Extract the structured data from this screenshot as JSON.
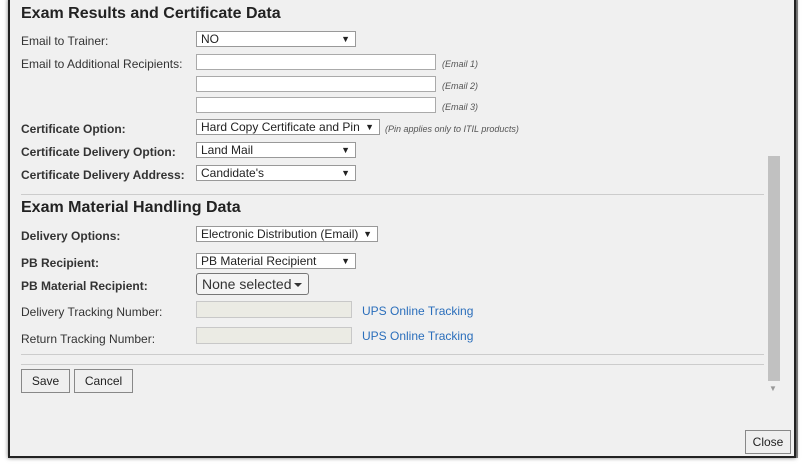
{
  "section1": {
    "title": "Exam Results and Certificate Data",
    "email_trainer_label": "Email to Trainer:",
    "email_trainer_value": "NO",
    "email_additional_label": "Email to Additional Recipients:",
    "email_hints": [
      "(Email 1)",
      "(Email 2)",
      "(Email 3)"
    ],
    "cert_option_label": "Certificate Option:",
    "cert_option_value": "Hard Copy Certificate and Pin",
    "cert_option_hint": "(Pin applies only to ITIL products)",
    "cert_delivery_label": "Certificate Delivery Option:",
    "cert_delivery_value": "Land Mail",
    "cert_address_label": "Certificate Delivery Address:",
    "cert_address_value": "Candidate's"
  },
  "section2": {
    "title": "Exam Material Handling Data",
    "delivery_options_label": "Delivery Options:",
    "delivery_options_value": "Electronic Distribution (Email)",
    "pb_recipient_label": "PB Recipient:",
    "pb_recipient_value": "PB Material Recipient",
    "pb_material_label": "PB Material Recipient:",
    "pb_material_value": "None selected",
    "delivery_tracking_label": "Delivery Tracking Number:",
    "return_tracking_label": "Return Tracking Number:",
    "ups_link": "UPS Online Tracking"
  },
  "buttons": {
    "save": "Save",
    "cancel": "Cancel",
    "close": "Close"
  },
  "icons": {
    "dropdown": "triangle-down",
    "scroll_down": "triangle-down"
  }
}
